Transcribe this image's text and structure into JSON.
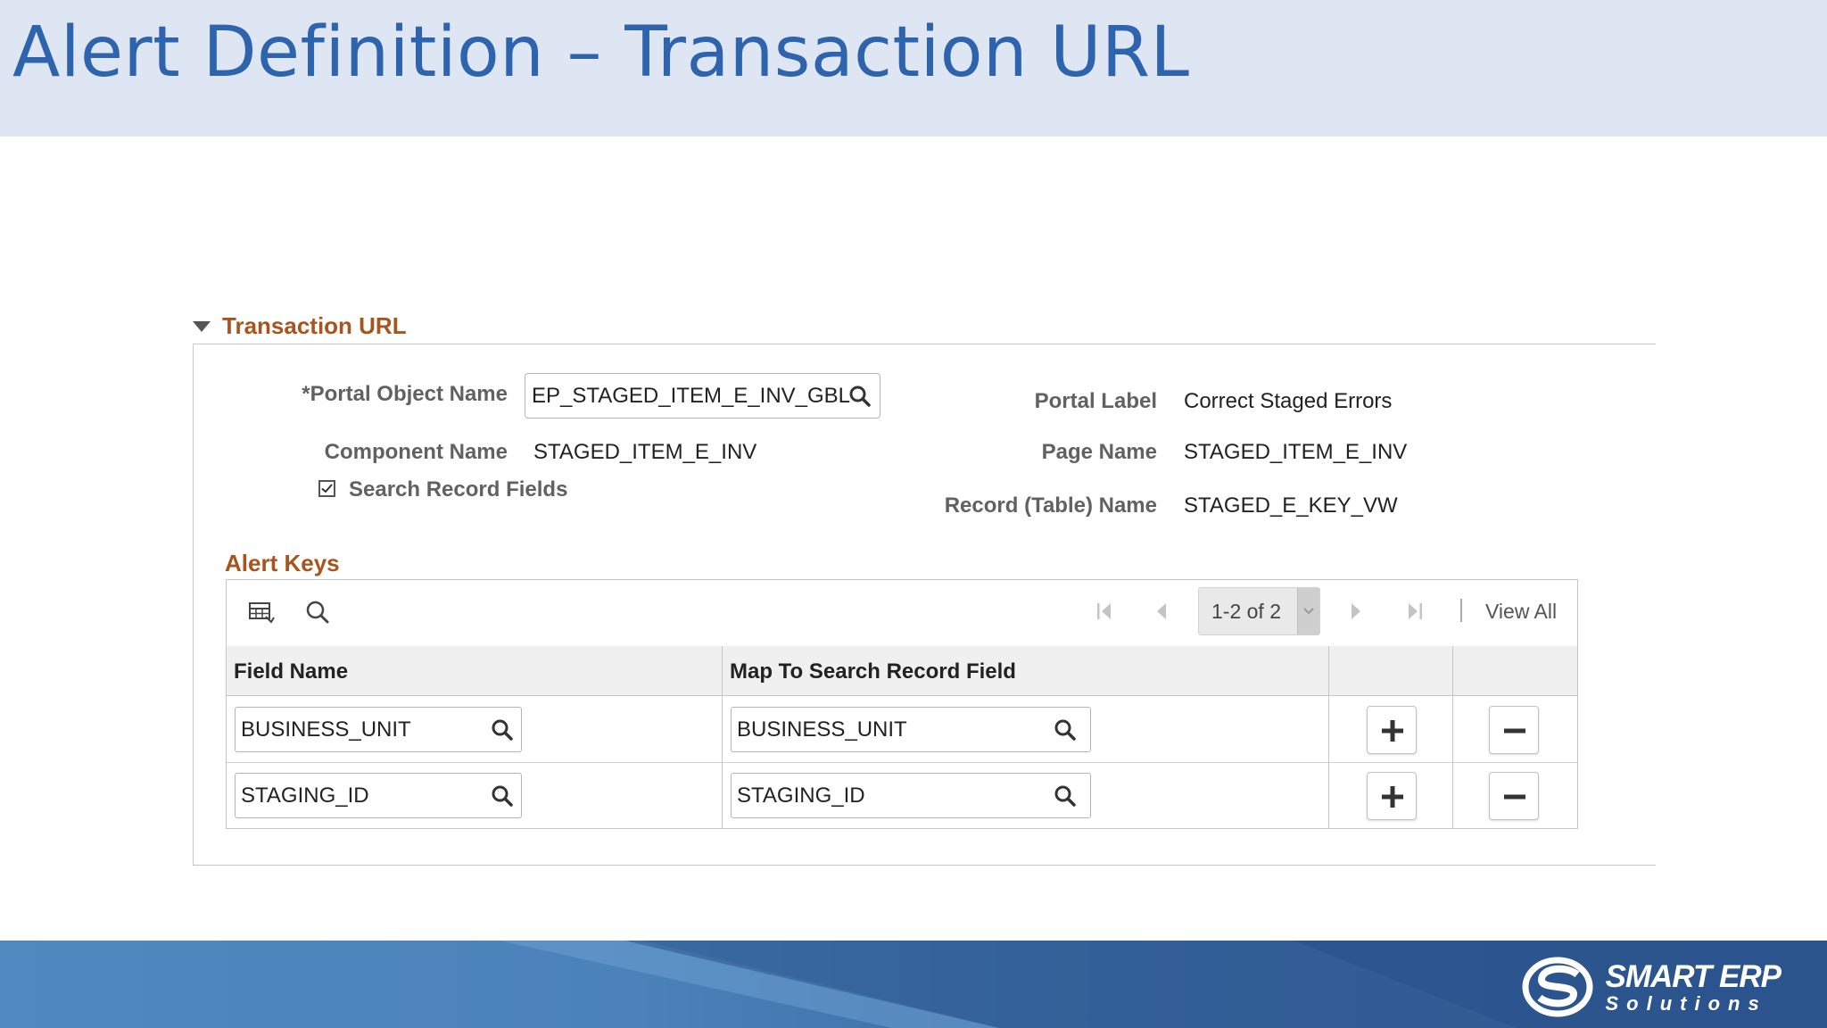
{
  "slide": {
    "title": "Alert Definition – Transaction URL"
  },
  "section": {
    "title": "Transaction URL"
  },
  "form": {
    "portal_object_label": "*Portal Object Name",
    "portal_object_value": "EP_STAGED_ITEM_E_INV_GBL",
    "component_label": "Component Name",
    "component_value": "STAGED_ITEM_E_INV",
    "search_record_fields_label": "Search Record Fields",
    "search_record_fields_checked": true,
    "portal_label_label": "Portal Label",
    "portal_label_value": "Correct Staged Errors",
    "page_name_label": "Page Name",
    "page_name_value": "STAGED_ITEM_E_INV",
    "record_name_label": "Record (Table) Name",
    "record_name_value": "STAGED_E_KEY_VW"
  },
  "alert_keys": {
    "title": "Alert Keys",
    "count": "1-2 of 2",
    "view_all": "View All",
    "columns": [
      "Field Name",
      "Map To Search Record Field"
    ],
    "rows": [
      {
        "field_name": "BUSINESS_UNIT",
        "map_field": "BUSINESS_UNIT"
      },
      {
        "field_name": "STAGING_ID",
        "map_field": "STAGING_ID"
      }
    ]
  },
  "footer": {
    "logo_line1": "SMART ERP",
    "logo_line2": "Solutions"
  },
  "colors": {
    "title_blue": "#2e63ad",
    "section_orange": "#a8541e",
    "title_band": "#dfe6f3",
    "footer_blue": "#3b6aa3"
  }
}
